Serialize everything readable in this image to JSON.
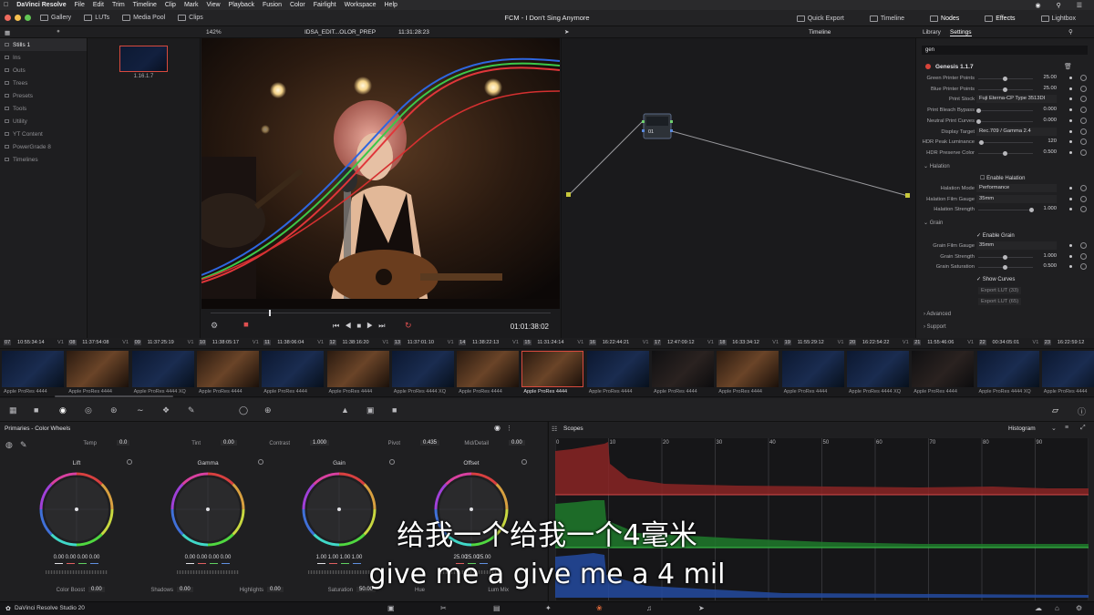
{
  "menubar": {
    "app_name": "DaVinci Resolve",
    "items": [
      "File",
      "Edit",
      "Trim",
      "Timeline",
      "Clip",
      "Mark",
      "View",
      "Playback",
      "Fusion",
      "Color",
      "Fairlight",
      "Workspace",
      "Help"
    ]
  },
  "toolbar": {
    "left_buttons": [
      "Gallery",
      "LUTs",
      "Media Pool",
      "Clips"
    ],
    "project_title": "FCM - I Don't Sing Anymore",
    "right_buttons": [
      "Quick Export",
      "Timeline",
      "Nodes",
      "Effects",
      "Lightbox"
    ]
  },
  "subbar": {
    "zoom": "142%",
    "timeline_name": "IDSA_EDIT...OLOR_PREP",
    "timecode": "11:31:28:23",
    "mode_label": "Timeline",
    "tabs": [
      "Library",
      "Settings"
    ]
  },
  "gallery": {
    "items": [
      "Stills 1",
      "Ins",
      "Outs",
      "Trees",
      "Presets",
      "Tools",
      "Utility",
      "YT Content",
      "PowerGrade 8",
      "Timelines"
    ],
    "still_label": "1.16.1.7"
  },
  "viewer": {
    "timecode": "01:01:38:02"
  },
  "node": {
    "label": "01"
  },
  "settings": {
    "search": "gen",
    "plugin_name": "Genesis 1.1.7",
    "rows": [
      {
        "label": "Green Printer Points",
        "value": "25.00",
        "type": "slider",
        "level": 0.5
      },
      {
        "label": "Blue Printer Points",
        "value": "25.00",
        "type": "slider",
        "level": 0.5
      },
      {
        "label": "Print Stock",
        "value": "Fuji Eterna-CP Type 3513DI",
        "type": "dropdown"
      },
      {
        "label": "Print Bleach Bypass",
        "value": "0.000",
        "type": "slider",
        "level": 0.0
      },
      {
        "label": "Neutral Print Curves",
        "value": "0.000",
        "type": "slider",
        "level": 0.0
      },
      {
        "label": "Display Target",
        "value": "Rec.709 / Gamma 2.4",
        "type": "dropdown"
      },
      {
        "label": "HDR Peak Luminance",
        "value": "120",
        "type": "slider",
        "level": 0.05
      },
      {
        "label": "HDR Preserve Color",
        "value": "0.500",
        "type": "slider",
        "level": 0.5
      }
    ],
    "halation_section": "Halation",
    "halation_enable": "Enable Halation",
    "halation_rows": [
      {
        "label": "Halation Mode",
        "value": "Performance",
        "type": "dropdown"
      },
      {
        "label": "Halation Film Gauge",
        "value": "35mm",
        "type": "dropdown"
      },
      {
        "label": "Halation Strength",
        "value": "1.000",
        "type": "slider",
        "level": 1.0
      }
    ],
    "grain_section": "Grain",
    "grain_enable": "Enable Grain",
    "grain_rows": [
      {
        "label": "Grain Film Gauge",
        "value": "35mm",
        "type": "dropdown"
      },
      {
        "label": "Grain Strength",
        "value": "1.000",
        "type": "slider",
        "level": 0.5
      },
      {
        "label": "Grain Saturation",
        "value": "0.500",
        "type": "slider",
        "level": 0.5
      }
    ],
    "show_curves": "Show Curves",
    "export_buttons": [
      "Export LUT (33)",
      "Export LUT (65)"
    ],
    "bottom_sections": [
      "Advanced",
      "Support"
    ]
  },
  "clips": [
    {
      "num": "07",
      "tc": "10:55:34:14",
      "track": "V1",
      "codec": "Apple ProRes 4444",
      "tone": "blue"
    },
    {
      "num": "08",
      "tc": "11:37:54:08",
      "track": "V1",
      "codec": "Apple ProRes 4444",
      "tone": "warm"
    },
    {
      "num": "09",
      "tc": "11:37:25:19",
      "track": "V1",
      "codec": "Apple ProRes 4444 XQ",
      "tone": "blue"
    },
    {
      "num": "10",
      "tc": "11:38:05:17",
      "track": "V1",
      "codec": "Apple ProRes 4444",
      "tone": "warm"
    },
    {
      "num": "11",
      "tc": "11:38:06:04",
      "track": "V1",
      "codec": "Apple ProRes 4444",
      "tone": "blue"
    },
    {
      "num": "12",
      "tc": "11:38:16:20",
      "track": "V1",
      "codec": "Apple ProRes 4444",
      "tone": "warm"
    },
    {
      "num": "13",
      "tc": "11:37:01:10",
      "track": "V1",
      "codec": "Apple ProRes 4444 XQ",
      "tone": "blue"
    },
    {
      "num": "14",
      "tc": "11:38:22:13",
      "track": "V1",
      "codec": "Apple ProRes 4444",
      "tone": "warm"
    },
    {
      "num": "15",
      "tc": "11:31:24:14",
      "track": "V1",
      "codec": "Apple ProRes 4444",
      "tone": "warm",
      "selected": true
    },
    {
      "num": "16",
      "tc": "16:22:44:21",
      "track": "V1",
      "codec": "Apple ProRes 4444",
      "tone": "blue"
    },
    {
      "num": "17",
      "tc": "12:47:09:12",
      "track": "V1",
      "codec": "Apple ProRes 4444",
      "tone": "dark"
    },
    {
      "num": "18",
      "tc": "16:33:34:12",
      "track": "V1",
      "codec": "Apple ProRes 4444",
      "tone": "warm"
    },
    {
      "num": "19",
      "tc": "11:55:29:12",
      "track": "V1",
      "codec": "Apple ProRes 4444",
      "tone": "blue"
    },
    {
      "num": "20",
      "tc": "16:22:54:22",
      "track": "V1",
      "codec": "Apple ProRes 4444 XQ",
      "tone": "blue"
    },
    {
      "num": "21",
      "tc": "11:55:46:06",
      "track": "V1",
      "codec": "Apple ProRes 4444",
      "tone": "dark"
    },
    {
      "num": "22",
      "tc": "00:34:05:01",
      "track": "V1",
      "codec": "Apple ProRes 4444 XQ",
      "tone": "blue"
    },
    {
      "num": "23",
      "tc": "16:22:59:12",
      "track": "V1",
      "codec": "Apple ProRes 4444",
      "tone": "blue"
    }
  ],
  "primaries": {
    "title": "Primaries - Color Wheels",
    "top_params": [
      {
        "label": "Temp",
        "value": "0.0"
      },
      {
        "label": "Tint",
        "value": "0.00"
      },
      {
        "label": "Contrast",
        "value": "1.000"
      },
      {
        "label": "Pivot",
        "value": "0.435"
      },
      {
        "label": "Mid/Detail",
        "value": "0.00"
      }
    ],
    "wheels": [
      {
        "name": "Lift",
        "values": [
          "0.00",
          "0.00",
          "0.00",
          "0.00"
        ]
      },
      {
        "name": "Gamma",
        "values": [
          "0.00",
          "0.00",
          "0.00",
          "0.00"
        ]
      },
      {
        "name": "Gain",
        "values": [
          "1.00",
          "1.00",
          "1.00",
          "1.00"
        ]
      },
      {
        "name": "Offset",
        "values": [
          "25.00",
          "25.00",
          "25.00"
        ]
      }
    ],
    "bottom_params": [
      {
        "label": "Color Boost",
        "value": "0.00"
      },
      {
        "label": "Shadows",
        "value": "0.00"
      },
      {
        "label": "Highlights",
        "value": "0.00"
      },
      {
        "label": "Saturation",
        "value": "50.00"
      },
      {
        "label": "Hue",
        "value": ""
      },
      {
        "label": "Lum Mix",
        "value": ""
      }
    ]
  },
  "scopes": {
    "title": "Scopes",
    "mode": "Histogram",
    "ticks": [
      "0",
      "10",
      "20",
      "30",
      "40",
      "50",
      "60",
      "70",
      "80",
      "90",
      "100"
    ]
  },
  "status": {
    "app_version": "DaVinci Resolve Studio 20"
  },
  "subtitles": {
    "cn": "给我一个给我一个4毫米",
    "en": "give me a give me a 4 mil"
  }
}
